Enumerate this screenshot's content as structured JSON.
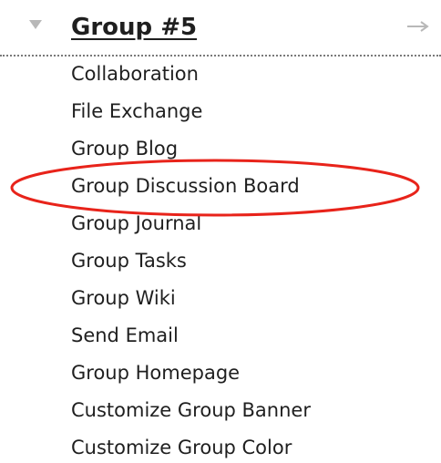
{
  "group": {
    "title": "Group #5",
    "collapse_icon": "triangle-down-icon",
    "go_icon": "arrow-right-icon"
  },
  "menu": {
    "items": [
      {
        "label": "Collaboration"
      },
      {
        "label": "File Exchange"
      },
      {
        "label": "Group Blog"
      },
      {
        "label": "Group Discussion Board"
      },
      {
        "label": "Group Journal"
      },
      {
        "label": "Group Tasks"
      },
      {
        "label": "Group Wiki"
      },
      {
        "label": "Send Email"
      },
      {
        "label": "Group Homepage"
      },
      {
        "label": "Customize Group Banner"
      },
      {
        "label": "Customize Group Color"
      }
    ]
  },
  "annotation": {
    "highlighted_item": "Group Discussion Board",
    "color": "#e8231a"
  },
  "colors": {
    "text": "#1f1f1f",
    "icon": "#b8b8b8",
    "divider": "#7a7a7a"
  }
}
